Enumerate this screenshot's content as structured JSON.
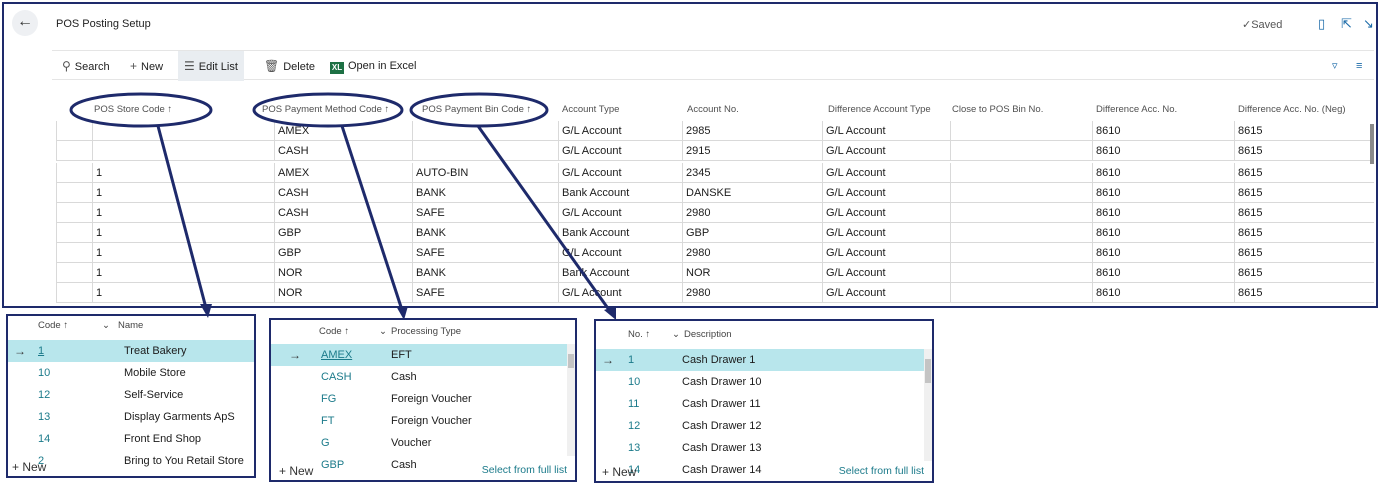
{
  "header": {
    "title": "POS Posting Setup",
    "saved_label": "Saved",
    "saved_icon": "check-icon",
    "back_icon": "back-arrow-icon"
  },
  "toolbar": {
    "search": "Search",
    "new": "New",
    "edit_list": "Edit List",
    "delete": "Delete",
    "open_in_excel": "Open in Excel",
    "excel_badge": "XL"
  },
  "grid": {
    "columns": [
      "POS Store Code ↑",
      "POS Payment Method Code ↑",
      "POS Payment Bin Code ↑",
      "Account Type",
      "Account No.",
      "Difference Account Type",
      "Close to POS Bin No.",
      "Difference Acc. No.",
      "Difference Acc. No. (Neg)"
    ],
    "rows": [
      [
        "",
        "AMEX",
        "",
        "G/L Account",
        "2985",
        "G/L Account",
        "",
        "8610",
        "8615"
      ],
      [
        "",
        "CASH",
        "",
        "G/L Account",
        "2915",
        "G/L Account",
        "",
        "8610",
        "8615"
      ],
      [
        "1",
        "AMEX",
        "AUTO-BIN",
        "G/L Account",
        "2345",
        "G/L Account",
        "",
        "8610",
        "8615"
      ],
      [
        "1",
        "CASH",
        "BANK",
        "Bank Account",
        "DANSKE",
        "G/L Account",
        "",
        "8610",
        "8615"
      ],
      [
        "1",
        "CASH",
        "SAFE",
        "G/L Account",
        "2980",
        "G/L Account",
        "",
        "8610",
        "8615"
      ],
      [
        "1",
        "GBP",
        "BANK",
        "Bank Account",
        "GBP",
        "G/L Account",
        "",
        "8610",
        "8615"
      ],
      [
        "1",
        "GBP",
        "SAFE",
        "G/L Account",
        "2980",
        "G/L Account",
        "",
        "8610",
        "8615"
      ],
      [
        "1",
        "NOR",
        "BANK",
        "Bank Account",
        "NOR",
        "G/L Account",
        "",
        "8610",
        "8615"
      ],
      [
        "1",
        "NOR",
        "SAFE",
        "G/L Account",
        "2980",
        "G/L Account",
        "",
        "8610",
        "8615"
      ]
    ]
  },
  "store_lookup": {
    "col_code": "Code ↑",
    "col_name": "Name",
    "rows": [
      {
        "code": "1",
        "name": "Treat Bakery"
      },
      {
        "code": "10",
        "name": "Mobile Store"
      },
      {
        "code": "12",
        "name": "Self-Service"
      },
      {
        "code": "13",
        "name": "Display Garments ApS"
      },
      {
        "code": "14",
        "name": "Front End Shop"
      },
      {
        "code": "2",
        "name": "Bring to You Retail Store"
      }
    ],
    "new_label": "New"
  },
  "method_lookup": {
    "col_code": "Code ↑",
    "col_type": "Processing Type",
    "rows": [
      {
        "code": "AMEX",
        "type": "EFT"
      },
      {
        "code": "CASH",
        "type": "Cash"
      },
      {
        "code": "FG",
        "type": "Foreign Voucher"
      },
      {
        "code": "FT",
        "type": "Foreign Voucher"
      },
      {
        "code": "G",
        "type": "Voucher"
      },
      {
        "code": "GBP",
        "type": "Cash"
      }
    ],
    "new_label": "New",
    "full_list_label": "Select from full list"
  },
  "bin_lookup": {
    "col_code": "No. ↑",
    "col_desc": "Description",
    "rows": [
      {
        "code": "1",
        "desc": "Cash Drawer 1"
      },
      {
        "code": "10",
        "desc": "Cash Drawer 10"
      },
      {
        "code": "11",
        "desc": "Cash Drawer 11"
      },
      {
        "code": "12",
        "desc": "Cash Drawer 12"
      },
      {
        "code": "13",
        "desc": "Cash Drawer 13"
      },
      {
        "code": "14",
        "desc": "Cash Drawer 14"
      }
    ],
    "new_label": "New",
    "full_list_label": "Select from full list"
  },
  "colors": {
    "frame_border": "#1e2a6b",
    "selected_row": "#b8e6ec",
    "link": "#1b7a8a",
    "annotation": "#1e2a6b"
  }
}
